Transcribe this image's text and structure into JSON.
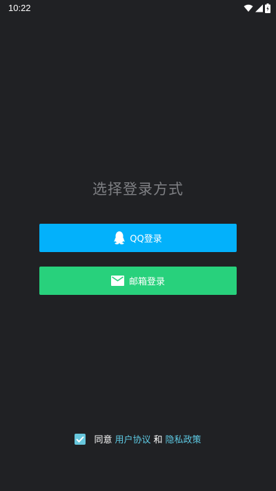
{
  "status_bar": {
    "time": "10:22"
  },
  "title": "选择登录方式",
  "buttons": {
    "qq_label": "QQ登录",
    "email_label": "邮箱登录"
  },
  "agreement": {
    "checked": true,
    "prefix": "同意",
    "user_agreement": "用户协议",
    "and": "和",
    "privacy_policy": "隐私政策"
  },
  "colors": {
    "background": "#202124",
    "qq_blue": "#03b1fb",
    "email_green": "#28d17c",
    "link": "#5ecae4"
  }
}
